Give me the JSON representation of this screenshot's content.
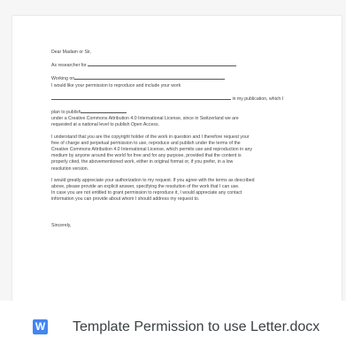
{
  "file": {
    "name": "Template Permission to use Letter.docx",
    "icon": "word-document-icon",
    "icon_letter": "W",
    "icon_color": "#4285f4"
  },
  "letter": {
    "salutation": "Dear Madam or Sir,",
    "researcher_prefix": "As researcher for",
    "working_on_prefix": "Working on",
    "permission_request": "I would like your permission to reproduce and include your work",
    "publication_suffix": "in my publication, which I",
    "plan_prefix": "plan to publish",
    "license_line_1": "under a Creative Commons Attribution 4.0 International License, since in Switzerland we are",
    "license_line_2": "requested at a national level to publish Open Access.",
    "paragraph_1": [
      "I understand that you are the copyright holder of the work in question and I therefore request your",
      "free of charge and perpetual permission to use, reproduce and publish under the terms of the",
      "Creative Commons Attribution 4.0 International License, which permits use and reproduction in any",
      "medium by anyone around the world for free and for any purpose, provided that the content is",
      "properly cited, the abovementioned work, either in original format or, if you prefer, in a low",
      "resolution version."
    ],
    "paragraph_2": [
      "I would greatly appreciate your authorization to my request. If you agree with the terms as described",
      "above, please provide an explicit answer, specifying the resolution of the work that I can use.",
      "In case you are not entitled to grant permission to reproduce it, I would appreciate any contact",
      "information you can provide about whom I should address my request to."
    ],
    "closing": "Sincerely,"
  }
}
